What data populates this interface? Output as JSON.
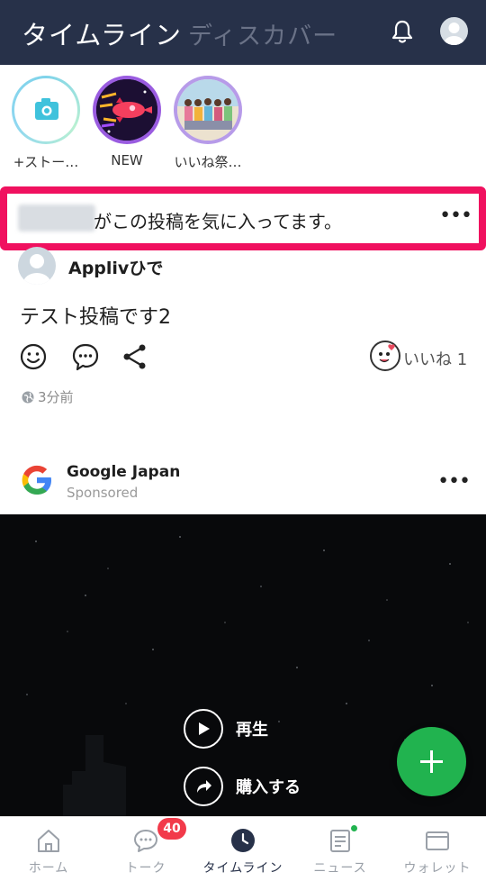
{
  "header": {
    "tab_timeline": "タイムライン",
    "tab_discover": "ディスカバー",
    "bg_color": "#273149"
  },
  "stories": [
    {
      "label": "+ストー…",
      "type": "camera"
    },
    {
      "label": "NEW",
      "type": "rocket"
    },
    {
      "label": "いいね祭…",
      "type": "photo"
    }
  ],
  "notice": {
    "text": "がこの投稿を気に入ってます。",
    "highlight_color": "#f0115f"
  },
  "post": {
    "author": "Applivひで",
    "body": "テスト投稿です2",
    "likes_label": "いいね 1",
    "time": "3分前"
  },
  "ad": {
    "name": "Google Japan",
    "sponsored": "Sponsored",
    "play_label": "再生",
    "buy_label": "購入する"
  },
  "nav": {
    "items": [
      {
        "label": "ホーム"
      },
      {
        "label": "トーク",
        "badge": "40"
      },
      {
        "label": "タイムライン",
        "active": true
      },
      {
        "label": "ニュース"
      },
      {
        "label": "ウォレット"
      }
    ]
  },
  "colors": {
    "accent_green": "#21b34f",
    "badge_red": "#f23a4a"
  }
}
